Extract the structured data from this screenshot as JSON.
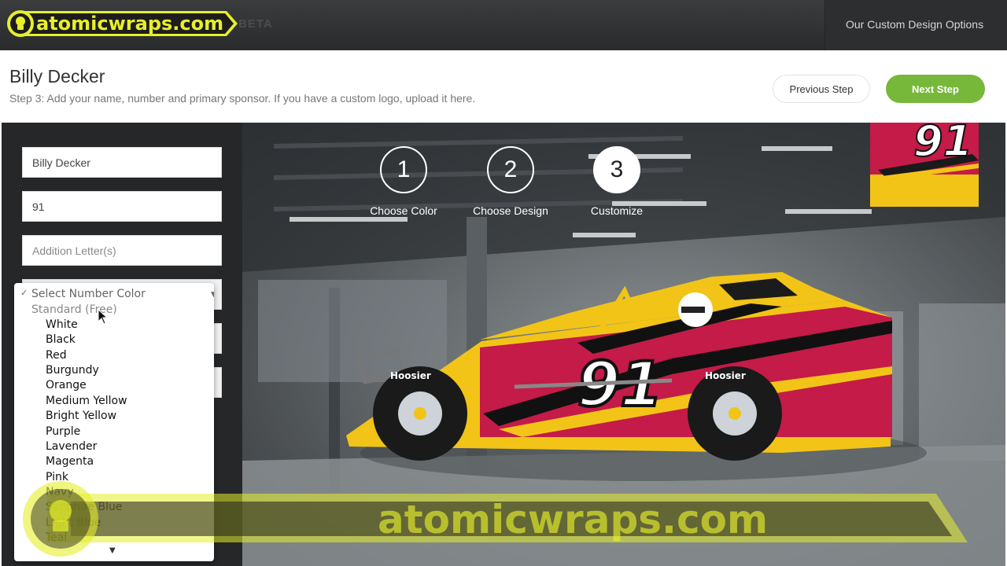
{
  "header": {
    "logo_text": "atomicwraps.com",
    "beta": "BETA",
    "nav_link": "Our Custom Design Options"
  },
  "page": {
    "title": "Billy Decker",
    "step_description": "Step 3: Add your name, number and primary sponsor. If you have a custom logo, upload it here.",
    "previous_label": "Previous Step",
    "next_label": "Next Step"
  },
  "form": {
    "name_value": "Billy Decker",
    "number_value": "91",
    "additional_placeholder": "Addition Letter(s)"
  },
  "number_color_dropdown": {
    "selected": "Select Number Color",
    "group": "Standard (Free)",
    "options": [
      "White",
      "Black",
      "Red",
      "Burgundy",
      "Orange",
      "Medium Yellow",
      "Bright Yellow",
      "Purple",
      "Lavender",
      "Magenta",
      "Pink",
      "Navy",
      "Sapphire Blue",
      "Light Blue",
      "Teal"
    ]
  },
  "steps": [
    {
      "number": "1",
      "label": "Choose Color"
    },
    {
      "number": "2",
      "label": "Choose Design"
    },
    {
      "number": "3",
      "label": "Customize"
    }
  ],
  "car": {
    "number": "91",
    "tire_brand": "Hoosier"
  },
  "watermark": {
    "text": "atomicwraps.com"
  },
  "colors": {
    "accent_green": "#77b73a",
    "wrap_yellow": "#f2c418",
    "wrap_red": "#c41b48",
    "logo_yellow": "#e6ef2a"
  }
}
